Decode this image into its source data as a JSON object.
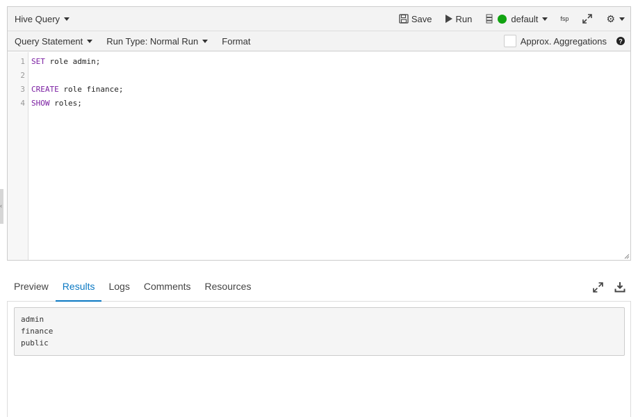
{
  "header": {
    "query_type": "Hive Query",
    "save_label": "Save",
    "run_label": "Run",
    "database": "default",
    "fsp_label": "fsp"
  },
  "subtoolbar": {
    "statement_mode": "Query Statement",
    "run_type": "Run Type: Normal Run",
    "format_label": "Format",
    "approx_label": "Approx. Aggregations"
  },
  "editor": {
    "lines": [
      {
        "num": "1",
        "kw": "SET",
        "rest": " role admin;"
      },
      {
        "num": "2",
        "kw": "",
        "rest": ""
      },
      {
        "num": "3",
        "kw": "CREATE",
        "rest": " role finance;"
      },
      {
        "num": "4",
        "kw": "SHOW",
        "rest": " roles;"
      }
    ]
  },
  "tabs": [
    {
      "label": "Preview"
    },
    {
      "label": "Results"
    },
    {
      "label": "Logs"
    },
    {
      "label": "Comments"
    },
    {
      "label": "Resources"
    }
  ],
  "active_tab": "Results",
  "results": {
    "rows": [
      "admin",
      "finance",
      "public"
    ]
  },
  "colors": {
    "accent": "#0a78c3",
    "keyword": "#7b1fa2",
    "status_ok": "#11a311"
  }
}
